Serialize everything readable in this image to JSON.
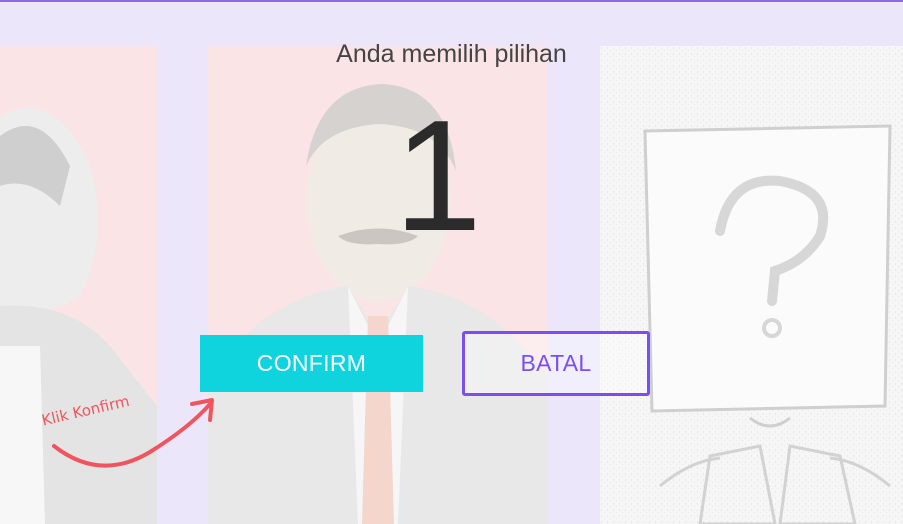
{
  "dialog": {
    "message": "Anda memilih pilihan",
    "selected_number": "1"
  },
  "buttons": {
    "confirm_label": "CONFIRM",
    "cancel_label": "BATAL"
  },
  "annotation": {
    "hint_text": "Klik Konfirm"
  },
  "candidates": [
    {
      "photo": "candidate-photo-red-bg"
    },
    {
      "photo": "candidate-photo-red-bg"
    },
    {
      "photo": "placeholder-unknown-person"
    }
  ],
  "colors": {
    "background": "#ece6fb",
    "top_border": "#8c6ce6",
    "confirm_bg": "#0fd4de",
    "batal_border": "#7a4ff0",
    "hint": "#f0555f"
  }
}
